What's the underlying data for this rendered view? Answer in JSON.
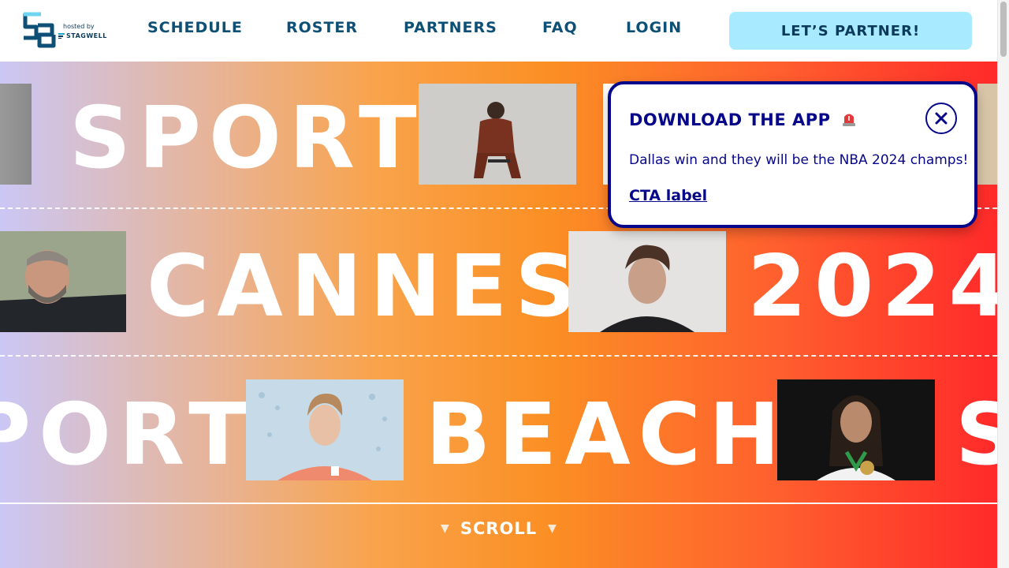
{
  "header": {
    "logo": {
      "hosted_label": "hosted by",
      "sponsor": "STAGWELL",
      "brand_color": "#0c3a5a"
    },
    "nav": [
      {
        "label": "SCHEDULE"
      },
      {
        "label": "ROSTER"
      },
      {
        "label": "PARTNERS"
      },
      {
        "label": "FAQ"
      },
      {
        "label": "LOGIN"
      }
    ],
    "cta_button": {
      "label": "LET’S PARTNER!",
      "color": "#a8eaff"
    }
  },
  "hero": {
    "row1": {
      "words": [
        "SPORT"
      ]
    },
    "row2": {
      "words": [
        "CANNES",
        "2024"
      ]
    },
    "row3": {
      "words": [
        "PORT",
        "BEACH",
        "S"
      ]
    },
    "scroll": {
      "label": "SCROLL",
      "arrow_icon": "triangle-down-icon"
    },
    "gradient_colors": [
      "#cbc7f5",
      "#f9a34a",
      "#ff2a2a"
    ]
  },
  "popup": {
    "title": "DOWNLOAD THE APP",
    "title_icon": "siren-icon",
    "body": "Dallas win and they will be the NBA 2024 champs!",
    "cta": "CTA label",
    "close_icon": "close-icon",
    "accent_color": "#07078a"
  }
}
